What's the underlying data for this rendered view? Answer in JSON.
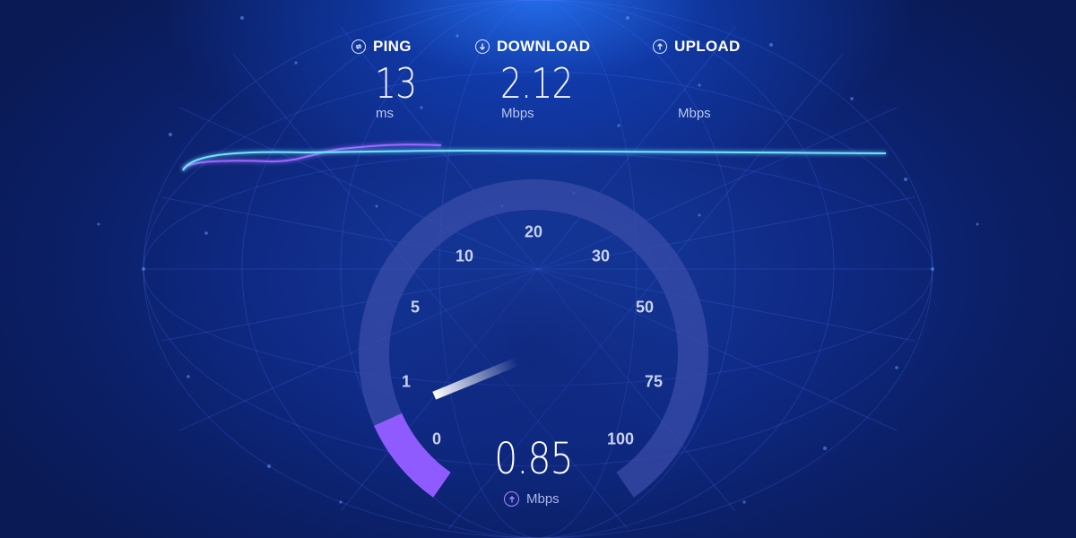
{
  "metrics": {
    "ping": {
      "label": "PING",
      "value": "13",
      "unit": "ms",
      "icon": "ping-icon"
    },
    "download": {
      "label": "DOWNLOAD",
      "value": "2.12",
      "unit": "Mbps",
      "icon": "download-arrow-icon"
    },
    "upload": {
      "label": "UPLOAD",
      "value": "",
      "unit": "Mbps",
      "icon": "upload-arrow-icon"
    }
  },
  "gauge": {
    "scale_labels": [
      "0",
      "1",
      "5",
      "10",
      "20",
      "30",
      "50",
      "75",
      "100"
    ],
    "current_value": "0.85",
    "current_unit": "Mbps",
    "unit_icon": "upload-arrow-icon",
    "needle_reading": 0.85
  },
  "colors": {
    "accent_purple": "#8f5bff",
    "graph_cyan": "#5fe0ff",
    "gauge_track": "#3a4ca8",
    "label_text": "#c9d2ef"
  }
}
